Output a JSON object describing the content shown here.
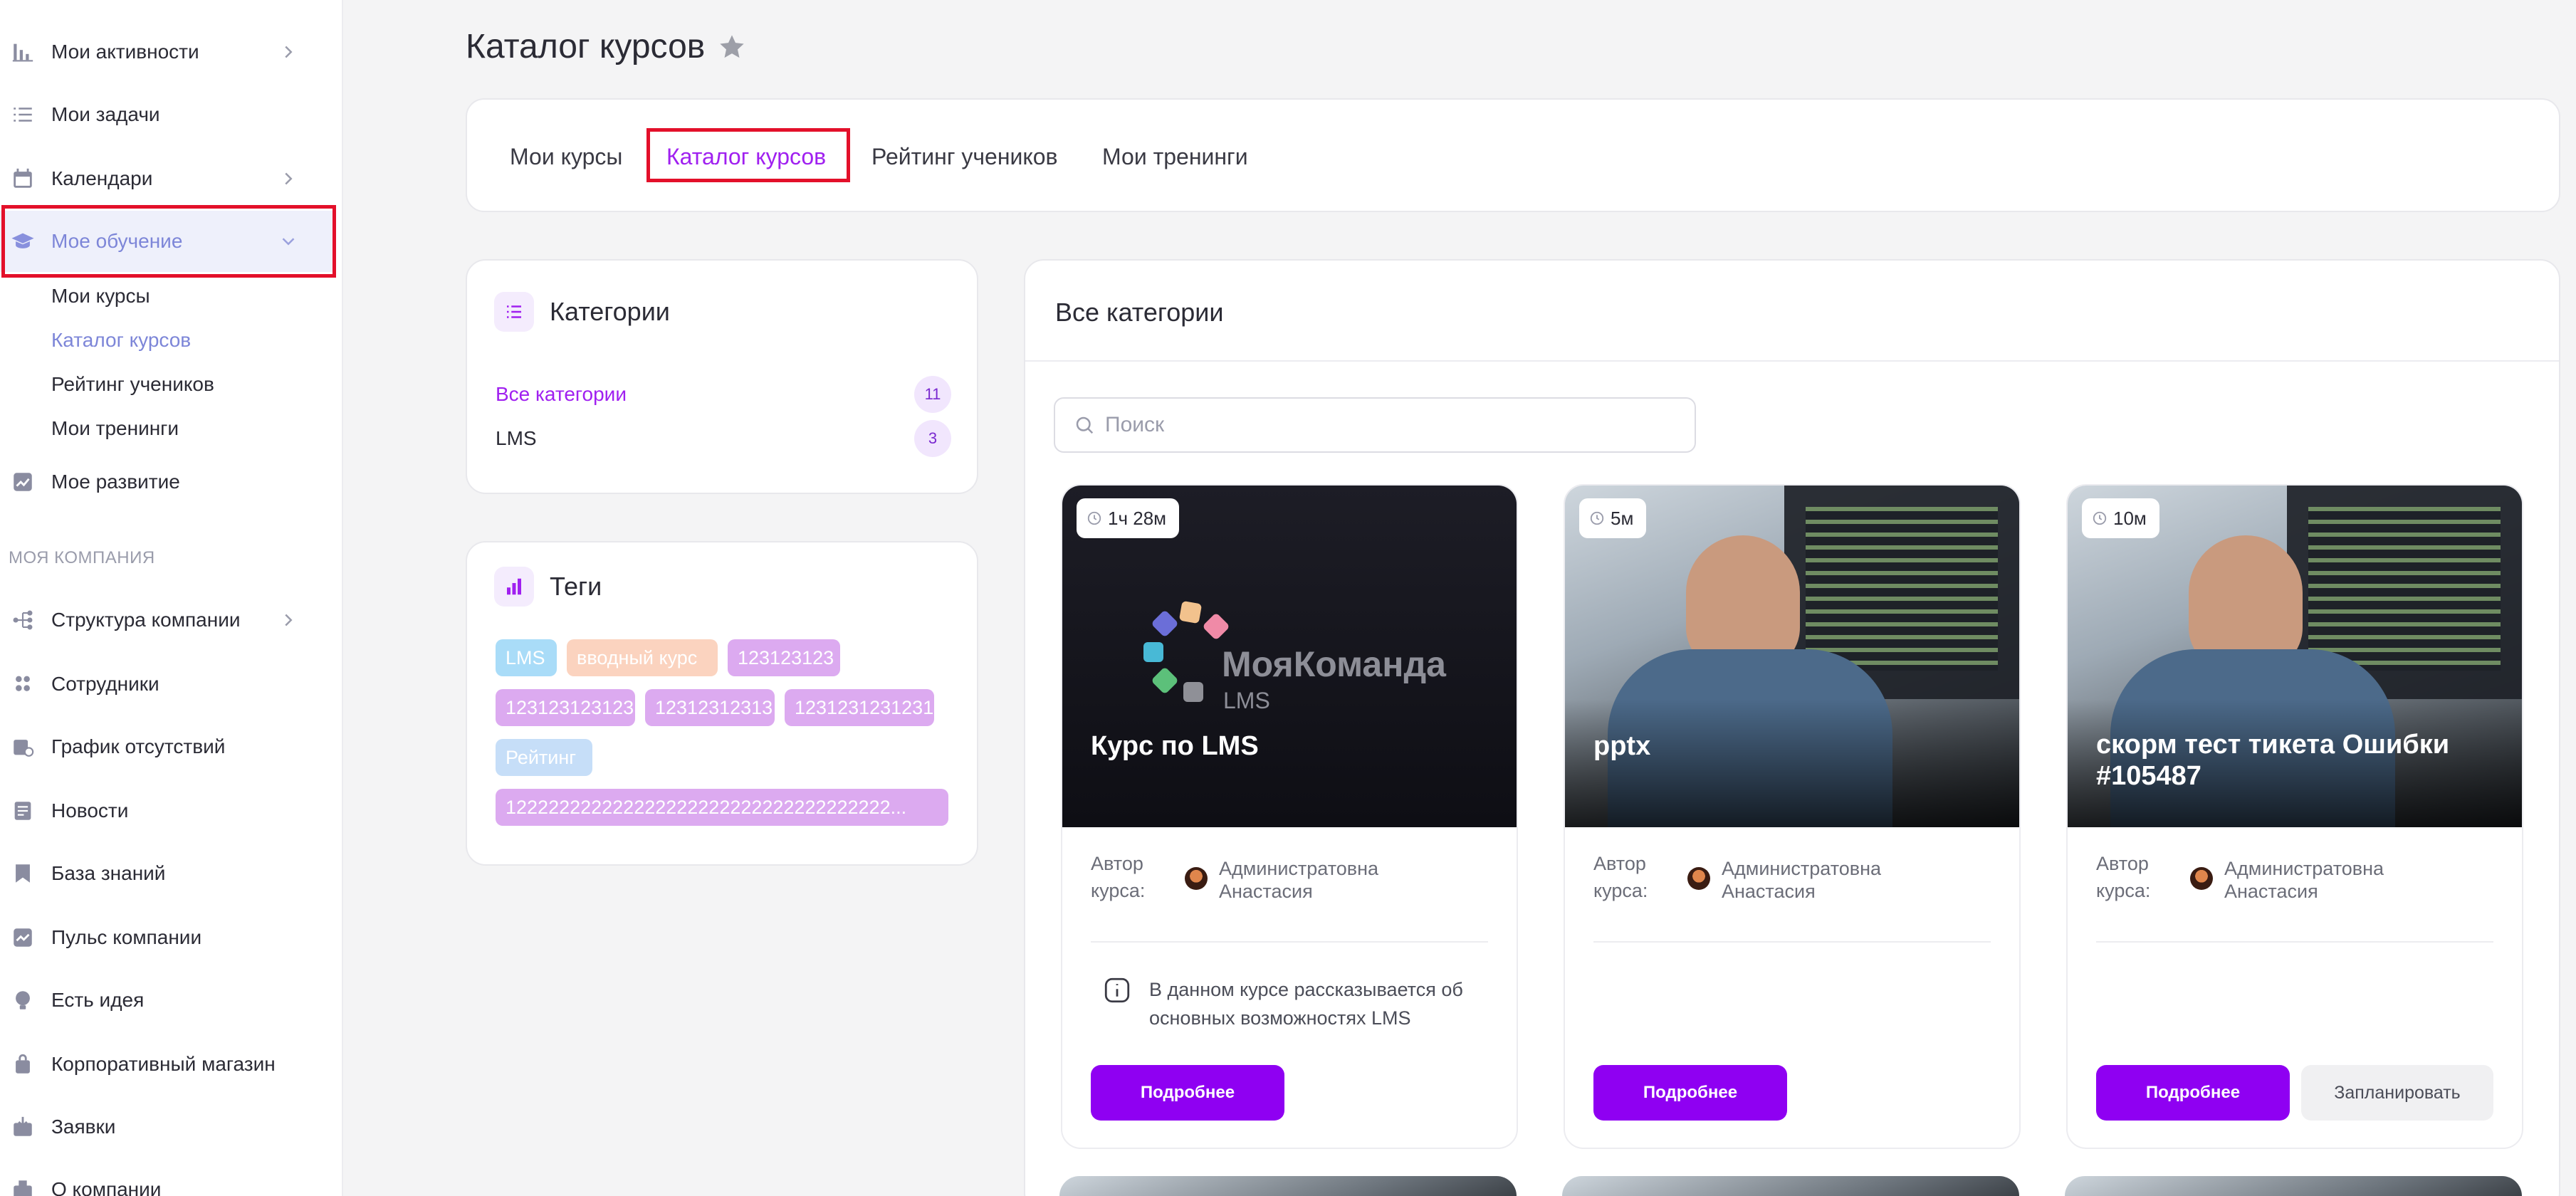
{
  "sidebar": {
    "items": [
      {
        "label": "Мои активности",
        "icon": "bar-chart-icon",
        "chevron": "right"
      },
      {
        "label": "Мои задачи",
        "icon": "task-list-icon"
      },
      {
        "label": "Календари",
        "icon": "calendar-icon",
        "chevron": "right"
      },
      {
        "label": "Мое обучение",
        "icon": "graduation-cap-icon",
        "chevron": "down"
      },
      {
        "label": "Мое развитие",
        "icon": "growth-chart-icon"
      }
    ],
    "sub_items": [
      "Мои курсы",
      "Каталог курсов",
      "Рейтинг учеников",
      "Мои тренинги"
    ],
    "section_title": "МОЯ КОМПАНИЯ",
    "company_items": [
      {
        "label": "Структура компании",
        "icon": "org-structure-icon",
        "chevron": "right"
      },
      {
        "label": "Сотрудники",
        "icon": "people-icon"
      },
      {
        "label": "График отсутствий",
        "icon": "absence-calendar-icon"
      },
      {
        "label": "Новости",
        "icon": "news-icon"
      },
      {
        "label": "База знаний",
        "icon": "bookmark-icon"
      },
      {
        "label": "Пульс компании",
        "icon": "pulse-icon"
      },
      {
        "label": "Есть идея",
        "icon": "lightbulb-icon"
      },
      {
        "label": "Корпоративный магазин",
        "icon": "shop-icon"
      },
      {
        "label": "Заявки",
        "icon": "inbox-icon"
      },
      {
        "label": "О компании",
        "icon": "building-icon"
      }
    ]
  },
  "page": {
    "title": "Каталог курсов"
  },
  "tabs": [
    "Мои курсы",
    "Каталог курсов",
    "Рейтинг учеников",
    "Мои тренинги"
  ],
  "categories": {
    "title": "Категории",
    "items": [
      {
        "label": "Все категории",
        "count": "11"
      },
      {
        "label": "LMS",
        "count": "3"
      }
    ]
  },
  "tags": {
    "title": "Теги",
    "items": [
      {
        "label": "LMS",
        "color": "#a9dcf8"
      },
      {
        "label": "вводный курс",
        "color": "#fbd3bf"
      },
      {
        "label": "123123123",
        "color": "#dcaaf0"
      },
      {
        "label": "123123123123",
        "color": "#dcaaf0"
      },
      {
        "label": "12312312313",
        "color": "#dcaaf0"
      },
      {
        "label": "1231231231231",
        "color": "#dcaaf0"
      },
      {
        "label": "Рейтинг",
        "color": "#c6def8"
      },
      {
        "label": "122222222222222222222222222222222222...",
        "color": "#dcaaf0"
      }
    ]
  },
  "catalog": {
    "title": "Все категории",
    "search_placeholder": "Поиск",
    "author_label": "Автор курса:",
    "courses": [
      {
        "duration": "1ч 28м",
        "title": "Курс по LMS",
        "author": "Администратовна Анастасия",
        "description": "В данном курсе рассказывается об основных возможностях LMS",
        "cover_brand": "МояКоманда",
        "cover_brand_sub": "LMS",
        "more_label": "Подробнее"
      },
      {
        "duration": "5м",
        "title": "pptx",
        "author": "Администратовна Анастасия",
        "more_label": "Подробнее"
      },
      {
        "duration": "10м",
        "title": "скорм тест тикета Ошибки #105487",
        "author": "Администратовна Анастасия",
        "more_label": "Подробнее",
        "plan_label": "Запланировать"
      }
    ]
  },
  "colors": {
    "accent": "#a020f0",
    "button": "#8f00f2",
    "highlight": "#e3102a",
    "active_nav": "#7d86d8"
  }
}
